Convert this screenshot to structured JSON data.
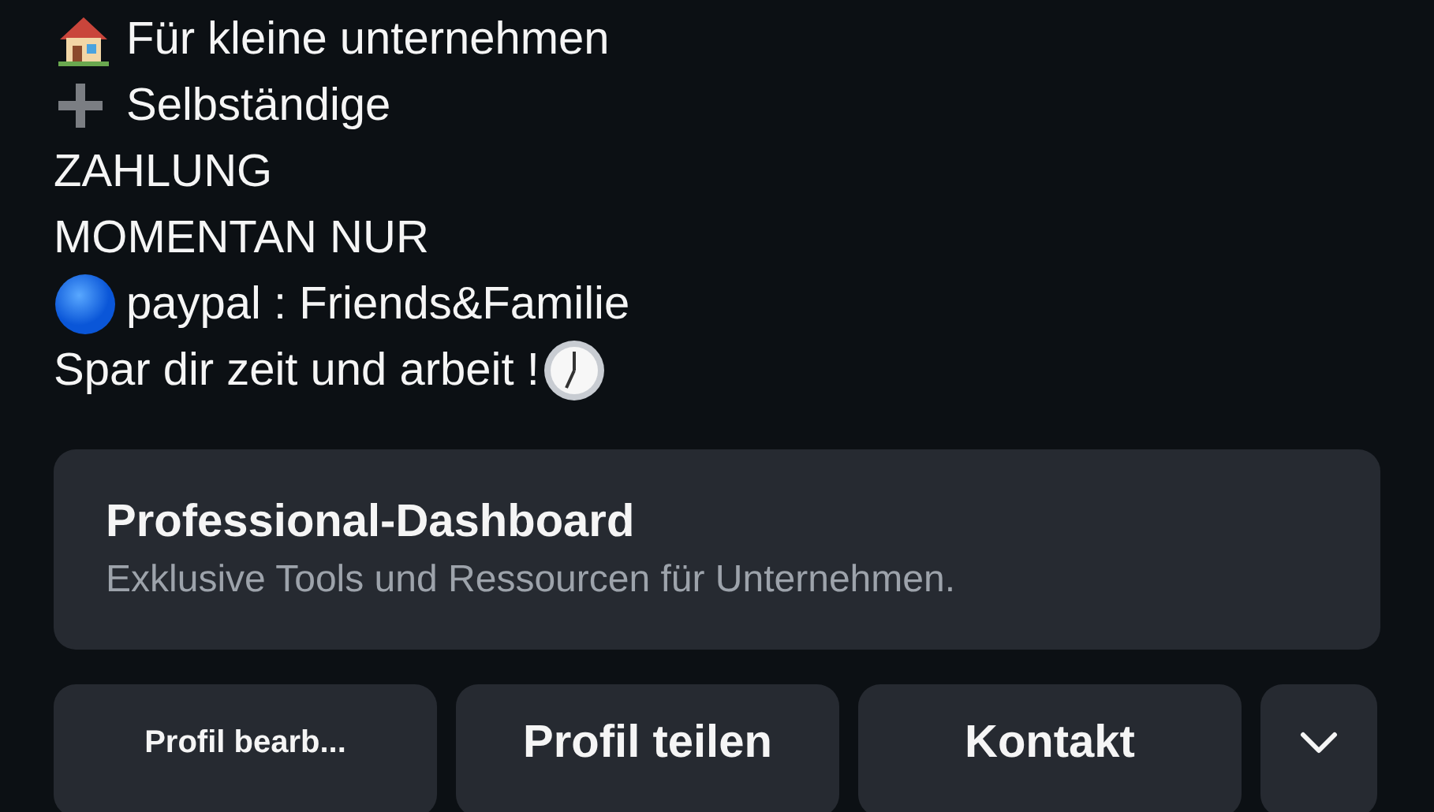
{
  "bio_lines": [
    {
      "kind": "house",
      "text": "Für kleine unternehmen"
    },
    {
      "kind": "plus",
      "text": "Selbständige"
    },
    {
      "kind": "plain",
      "text": "ZAHLUNG"
    },
    {
      "kind": "plain",
      "text": "MOMENTAN NUR"
    },
    {
      "kind": "dot",
      "text": "paypal : Friends&Familie"
    },
    {
      "kind": "clock",
      "text": "Spar dir zeit und arbeit !"
    }
  ],
  "dashboard": {
    "title": "Professional-Dashboard",
    "subtitle": "Exklusive Tools und Ressourcen für Unternehmen."
  },
  "buttons": [
    {
      "kind": "small",
      "label": "Profil bearb..."
    },
    {
      "kind": "text",
      "label": "Profil teilen"
    },
    {
      "kind": "text",
      "label": "Kontakt"
    },
    {
      "kind": "chevron"
    }
  ]
}
